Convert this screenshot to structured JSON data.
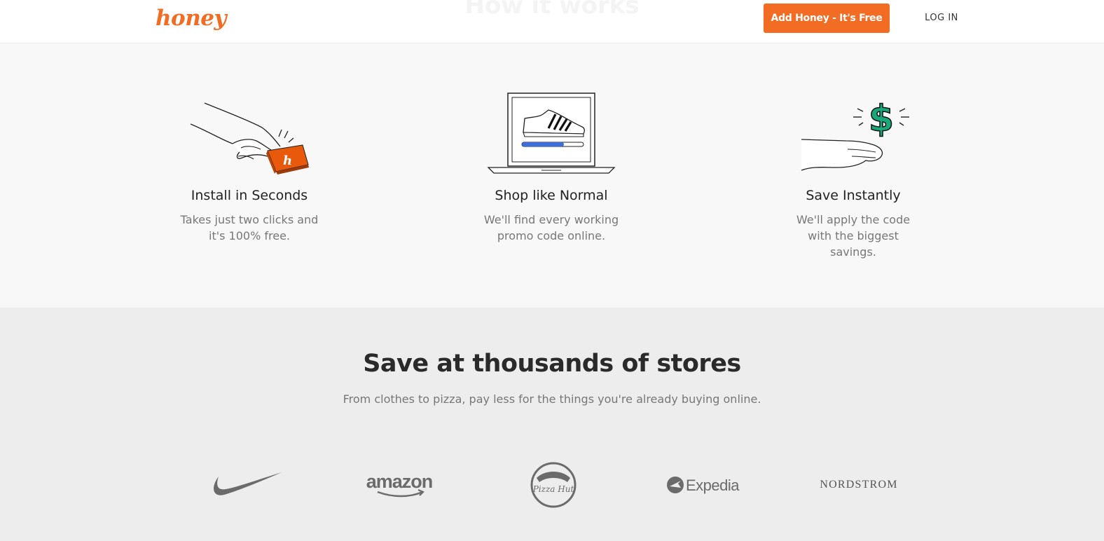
{
  "header": {
    "logo_text": "honey",
    "ghost_title": "How it works",
    "cta_label": "Add Honey - It's Free",
    "login_label": "LOG IN"
  },
  "steps": [
    {
      "title": "Install in Seconds",
      "desc": "Takes just two clicks and it's 100% free.",
      "icon": "hand-pressing-button-icon"
    },
    {
      "title": "Shop like Normal",
      "desc": "We'll find every working promo code online.",
      "icon": "laptop-shoe-icon"
    },
    {
      "title": "Save Instantly",
      "desc": "We'll apply the code with the biggest savings.",
      "icon": "hand-dollar-icon"
    }
  ],
  "stores": {
    "title": "Save at thousands of stores",
    "subtitle": "From clothes to pizza, pay less for the things you're already buying online.",
    "brands": [
      "nike",
      "amazon",
      "Pizza Hut",
      "Expedia",
      "NORDSTROM"
    ]
  },
  "colors": {
    "brand": "#f26c23",
    "dollar": "#1aa77a",
    "progress": "#3b6fe0"
  }
}
